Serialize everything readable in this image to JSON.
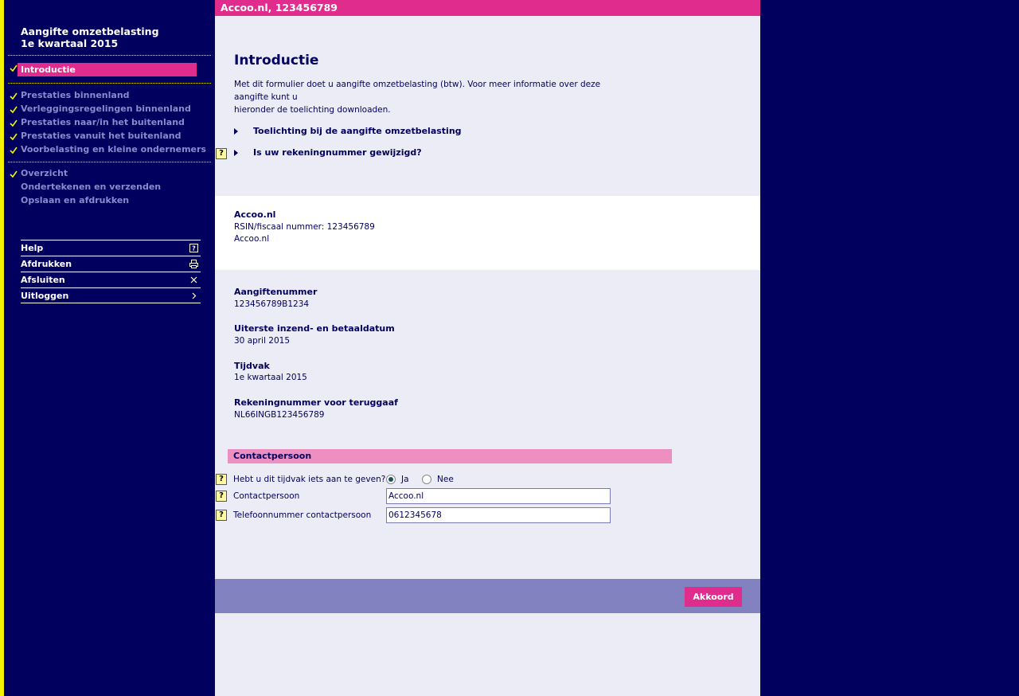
{
  "sidebar": {
    "title_line1": "Aangifte omzetbelasting",
    "title_line2": "1e kwartaal 2015",
    "active_item": "Introductie",
    "items_group1": [
      "Prestaties binnenland",
      "Verleggingsregelingen binnenland",
      "Prestaties naar/in het buitenland",
      "Prestaties vanuit het buitenland",
      "Voorbelasting en kleine ondernemers"
    ],
    "items_group2": [
      "Overzicht",
      "Ondertekenen en verzenden",
      "Opslaan en afdrukken"
    ],
    "menu": [
      "Help",
      "Afdrukken",
      "Afsluiten",
      "Uitloggen"
    ]
  },
  "header": {
    "title": "Accoo.nl, 123456789"
  },
  "intro": {
    "heading": "Introductie",
    "text_line1": "Met dit formulier doet u aangifte omzetbelasting (btw). Voor meer informatie over deze aangifte kunt u",
    "text_line2": "hieronder de toelichting downloaden.",
    "link1": "Toelichting bij de aangifte omzetbelasting",
    "link2": "Is uw rekeningnummer gewijzigd?"
  },
  "company": {
    "name": "Accoo.nl",
    "rsin": "RSIN/fiscaal nummer: 123456789",
    "name2": "Accoo.nl"
  },
  "details": {
    "aangiftenummer_label": "Aangiftenummer",
    "aangiftenummer": "123456789B1234",
    "datum_label": "Uiterste inzend- en betaaldatum",
    "datum": "30 april 2015",
    "tijdvak_label": "Tijdvak",
    "tijdvak": "1e kwartaal 2015",
    "rekening_label": "Rekeningnummer voor teruggaaf",
    "rekening": "NL66INGB123456789"
  },
  "contact": {
    "heading": "Contactpersoon",
    "question_label": "Hebt u dit tijdvak iets aan te geven?",
    "opt_yes": "Ja",
    "opt_no": "Nee",
    "name_label": "Contactpersoon",
    "name_value": "Accoo.nl",
    "phone_label": "Telefoonnummer contactpersoon",
    "phone_value": "0612345678"
  },
  "footer": {
    "akkoord": "Akkoord"
  },
  "colors": {
    "navy": "#01005e",
    "pink": "#e02d8d",
    "yellow": "#f3f300",
    "lavender": "#ececf6",
    "footer": "#8282c0"
  }
}
